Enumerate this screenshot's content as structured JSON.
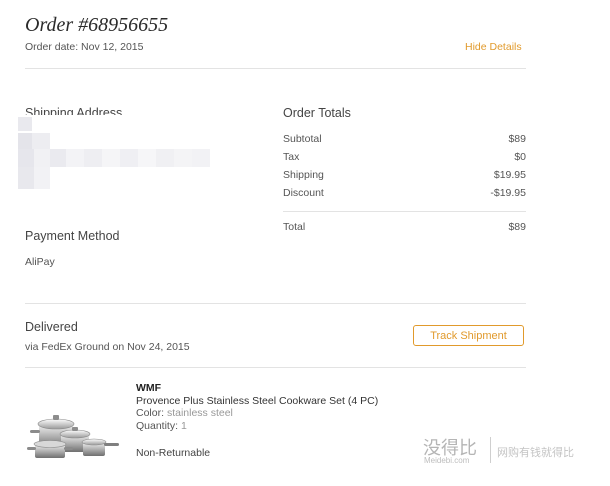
{
  "header": {
    "order_title": "Order #68956655",
    "order_date": "Order date: Nov 12, 2015",
    "hide_details": "Hide Details"
  },
  "shipping": {
    "heading": "Shipping Address"
  },
  "totals": {
    "heading": "Order Totals",
    "rows": [
      {
        "label": "Subtotal",
        "value": "$89"
      },
      {
        "label": "Tax",
        "value": "$0"
      },
      {
        "label": "Shipping",
        "value": "$19.95"
      },
      {
        "label": "Discount",
        "value": "-$19.95"
      }
    ],
    "total": {
      "label": "Total",
      "value": "$89"
    }
  },
  "payment": {
    "heading": "Payment Method",
    "method": "AliPay"
  },
  "delivery": {
    "status": "Delivered",
    "detail": "via FedEx Ground on Nov 24, 2015",
    "track_button": "Track Shipment"
  },
  "item": {
    "brand": "WMF",
    "name": "Provence Plus Stainless Steel Cookware Set (4 PC)",
    "color_label": "Color:",
    "color_value": "stainless steel",
    "quantity_label": "Quantity:",
    "quantity_value": "1",
    "returnable": "Non-Returnable"
  },
  "watermark": {
    "logo": "没得比",
    "site": "Meidebi.com",
    "tagline": "网购有钱就得比"
  },
  "colors": {
    "accent": "#e19a2c",
    "divider": "#e3e3e3"
  }
}
